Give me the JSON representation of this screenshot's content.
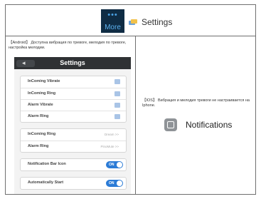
{
  "header": {
    "more_label": "More",
    "more_dots": "•••",
    "settings_title": "Settings"
  },
  "android": {
    "note": "【Android】 Доступна вибрация по тревоге, мелодия по тревоге, настройка мелодии.",
    "phone": {
      "title": "Settings",
      "back_label": "◂",
      "group1": [
        {
          "label": "InComing Vibrate"
        },
        {
          "label": "InComing Ring"
        },
        {
          "label": "Alarm Vibrate"
        },
        {
          "label": "Alarm Ring"
        }
      ],
      "group2": [
        {
          "label": "InComing Ring",
          "value": "Dream >>"
        },
        {
          "label": "Alarm Ring",
          "value": "PinoMute >>"
        }
      ],
      "group3": [
        {
          "label": "Notification Bar Icon",
          "toggle": "ON"
        }
      ],
      "group4": [
        {
          "label": "Automatically Start",
          "toggle": "ON"
        }
      ]
    }
  },
  "ios": {
    "note": "【IOS】 Вибрация и мелодия тревоги не настраивается на Iphone.",
    "notifications_label": "Notifications"
  },
  "colors": {
    "more_tile_bg": "#0f2c44",
    "more_text": "#5cb1ee",
    "nav_bar": "#2f3134",
    "toggle_on": "#2b7bd6",
    "checkbox": "#a9c4e6"
  }
}
